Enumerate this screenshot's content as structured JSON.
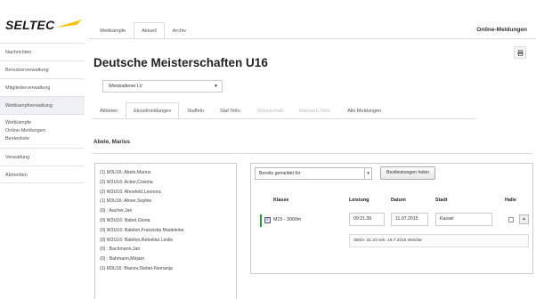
{
  "brand": {
    "logo_text": "SELTEC",
    "wing_color": "#f2c200"
  },
  "sidebar": {
    "items": [
      {
        "label": "Nachrichten"
      },
      {
        "label": "Benutzerverwaltung"
      },
      {
        "label": "Mitgliederverwaltung"
      },
      {
        "label": "Wettkampfverwaltung"
      },
      {
        "label_lines": [
          "Wettkämpfe",
          "Online-Meldungen",
          "Bestenliste"
        ]
      },
      {
        "label": "Verwaltung"
      },
      {
        "label": "Abmelden"
      }
    ]
  },
  "top_tabs": [
    {
      "label": "Wettkämpfe"
    },
    {
      "label": "Aktuell"
    },
    {
      "label": "Archiv"
    }
  ],
  "section_title": "Online-Meldungen",
  "page_title": "Deutsche Meisterschaften U16",
  "print_icon": "printer-icon",
  "club_select": {
    "value": "Wiesbadener LV"
  },
  "sub_tabs": [
    {
      "label": "Athleten"
    },
    {
      "label": "Einzelmeldungen"
    },
    {
      "label": "Staffeln"
    },
    {
      "label": "Staf.Teiln."
    },
    {
      "label": "Mannschaft"
    },
    {
      "label": "Mannsch.Teiln."
    },
    {
      "label": "Alle Meldungen"
    }
  ],
  "athlete_name": "Abele, Marius",
  "athletes": [
    "(1) M3U16: Abele,Marius",
    "(2) W3U16: Acker,Cosima",
    "(2) W3U16: Ahnefeld,Leonora",
    "(1) M3U16: Ahner,Sophie",
    "(0) : Aacher,Jan",
    "(0) W3U16: Babel,Gloria",
    "(0) W3U16: Babilon,Franziska Madeleine",
    "(0) W3U16: Babilon,Rebekka Leslie",
    "(0) : Bachmann,Jan",
    "(0) : Bahmann,Mirjam",
    "(1) M3U16: Bianov,Stefan-Nemanja"
  ],
  "filter": {
    "value": "Bereits gemeldet für",
    "load_button": "Bestleistungen holen"
  },
  "table": {
    "headers": {
      "klasse": "Klasse",
      "leistung": "Leistung",
      "datum": "Datum",
      "stadt": "Stadt",
      "halle": "Halle"
    },
    "row": {
      "checked": true,
      "klasse": "M15 - 3000m",
      "leistung": "09:21.39",
      "datum": "11.07.2015",
      "stadt": "Kassel"
    },
    "info": "300m: 41.23 sek. 19.7.2015 Wetzlar"
  }
}
